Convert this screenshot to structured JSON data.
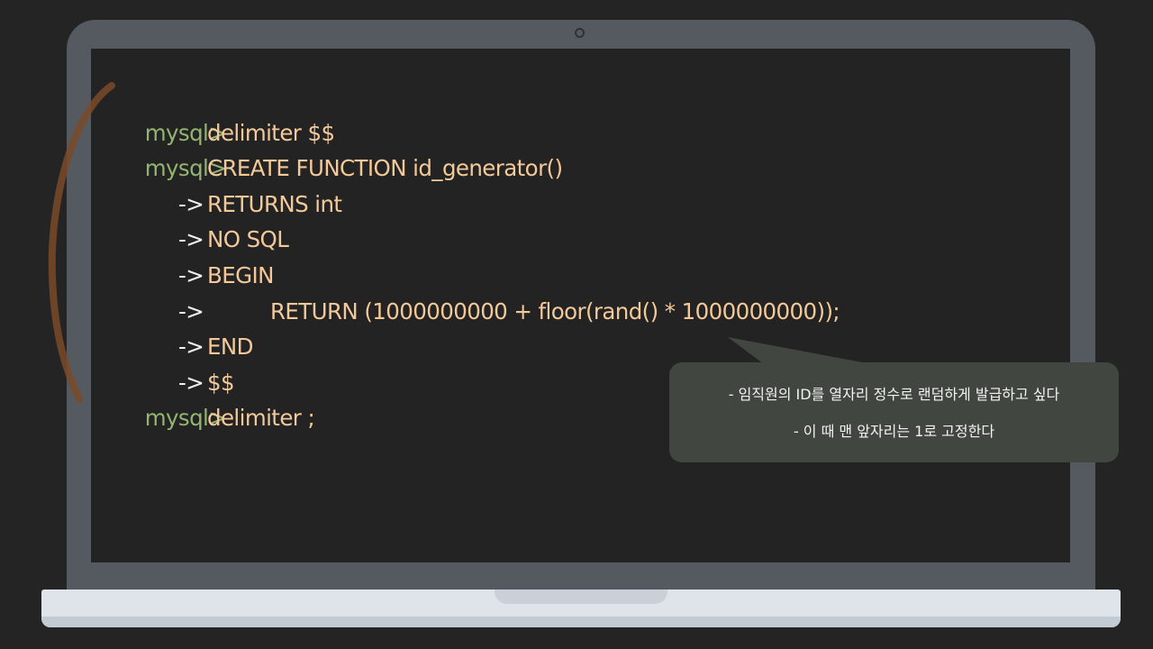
{
  "terminal": {
    "lines": [
      {
        "prompt": "mysql>",
        "arrow": "",
        "text": "delimiter $$"
      },
      {
        "prompt": "mysql>",
        "arrow": "",
        "text": "CREATE FUNCTION id_generator()"
      },
      {
        "prompt": "",
        "arrow": "->",
        "text": "RETURNS int"
      },
      {
        "prompt": "",
        "arrow": "->",
        "text": "NO SQL"
      },
      {
        "prompt": "",
        "arrow": "->",
        "text": "BEGIN"
      },
      {
        "prompt": "",
        "arrow": "->",
        "text": "RETURN (1000000000 + floor(rand() * 1000000000));"
      },
      {
        "prompt": "",
        "arrow": "->",
        "text": "END"
      },
      {
        "prompt": "",
        "arrow": "->",
        "text": "$$"
      },
      {
        "prompt": "mysql>",
        "arrow": "",
        "text": "delimiter ;"
      }
    ]
  },
  "note": {
    "line1": "- 임직원의 ID를 열자리 정수로 랜덤하게 발급하고 싶다",
    "line2": "- 이 때 맨 앞자리는 1로 고정한다"
  },
  "colors": {
    "prompt": "#93b56f",
    "code": "#f4c999",
    "arrow": "#f2f2f2",
    "screen": "#242324",
    "bezel": "#545a60",
    "bubble": "#414640",
    "pen": "#7a4a28"
  }
}
